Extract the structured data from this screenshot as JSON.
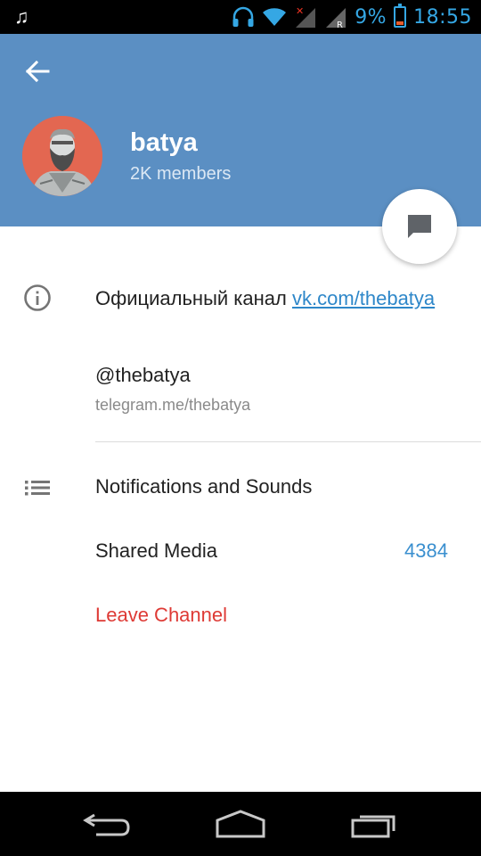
{
  "status_bar": {
    "time": "18:55",
    "battery_percent": "9%",
    "icons": [
      "music-note-icon",
      "headphones-icon",
      "wifi-icon",
      "signal-no-sim-icon",
      "signal-roaming-icon",
      "battery-icon"
    ]
  },
  "header": {
    "back_icon": "arrow-left-icon",
    "channel_name": "batya",
    "members": "2K members",
    "colors": {
      "header_bg": "#5b8fc3",
      "avatar_bg": "#e36751"
    }
  },
  "fab": {
    "icon": "chat-bubble-icon"
  },
  "info": {
    "icon": "info-icon",
    "description_prefix": "Официальный канал ",
    "description_link": "vk.com/thebatya",
    "username": "@thebatya",
    "link": "telegram.me/thebatya"
  },
  "settings": {
    "icon": "list-icon",
    "notifications_label": "Notifications and Sounds",
    "shared_media_label": "Shared Media",
    "shared_media_count": "4384",
    "leave_label": "Leave Channel"
  },
  "nav_bar": {
    "back_icon": "nav-back-icon",
    "home_icon": "nav-home-icon",
    "recents_icon": "nav-recents-icon"
  },
  "accent_colors": {
    "link": "#2e87c9",
    "danger": "#de3a35",
    "count": "#3a8fcf"
  }
}
